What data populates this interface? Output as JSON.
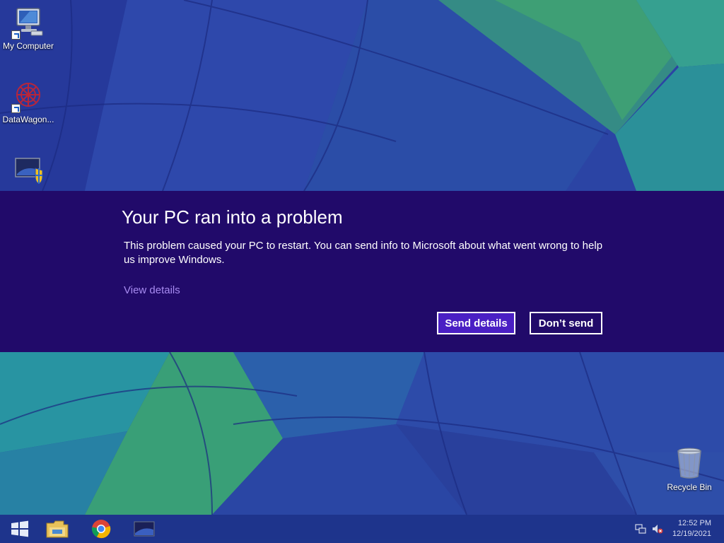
{
  "desktop": {
    "icons": [
      {
        "label": "My Computer",
        "icon": "computer-icon"
      },
      {
        "label": "DataWagon...",
        "icon": "datawagon-icon"
      },
      {
        "label": "",
        "icon": "shield-shortcut-icon"
      },
      {
        "label": "Recycle Bin",
        "icon": "recycle-bin-icon"
      }
    ]
  },
  "dialog": {
    "title": "Your PC ran into a problem",
    "body": "This problem caused your PC to restart. You can send info to Microsoft about what went wrong to help us improve Windows.",
    "view_details": "View details",
    "send_button": "Send details",
    "dont_send_button": "Don’t send",
    "background_color": "#210a6a",
    "accent_color": "#4a1fc4"
  },
  "taskbar": {
    "items": [
      "start-icon",
      "file-explorer-icon",
      "chrome-icon",
      "window-thumbnail-icon"
    ],
    "tray": [
      "network-icon",
      "volume-muted-icon"
    ],
    "time": "12:52 PM",
    "date": "12/19/2021"
  }
}
